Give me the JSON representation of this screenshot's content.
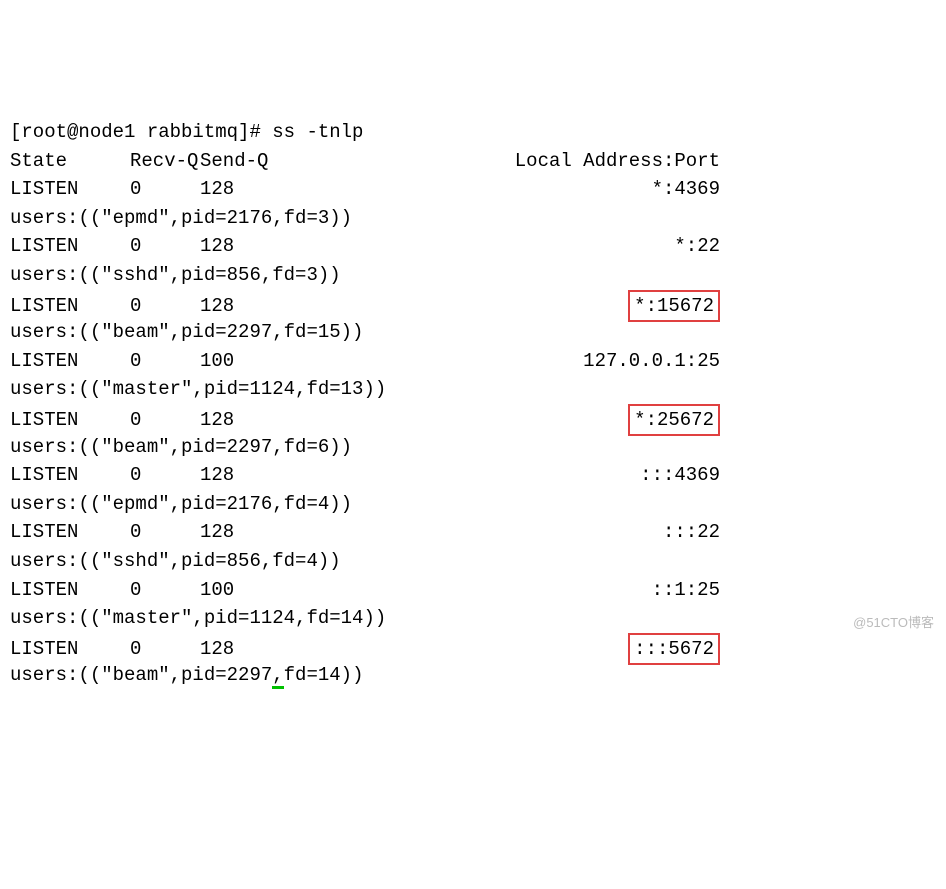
{
  "prompt": {
    "user": "root",
    "host": "node1",
    "cwd": "rabbitmq",
    "symbol": "#",
    "command": "ss -tnlp"
  },
  "header": {
    "state": "State",
    "recvq": "Recv-Q",
    "sendq": "Send-Q",
    "addr": "Local Address:Port"
  },
  "rows": [
    {
      "state": "LISTEN",
      "recvq": "0",
      "sendq": "128",
      "addr": "*:4369",
      "highlight": false,
      "users": "users:((\"epmd\",pid=2176,fd=3))"
    },
    {
      "state": "LISTEN",
      "recvq": "0",
      "sendq": "128",
      "addr": "*:22",
      "highlight": false,
      "users": "users:((\"sshd\",pid=856,fd=3))"
    },
    {
      "state": "LISTEN",
      "recvq": "0",
      "sendq": "128",
      "addr": "*:15672",
      "highlight": true,
      "users": "users:((\"beam\",pid=2297,fd=15))"
    },
    {
      "state": "LISTEN",
      "recvq": "0",
      "sendq": "100",
      "addr": "127.0.0.1:25",
      "highlight": false,
      "users": "users:((\"master\",pid=1124,fd=13))"
    },
    {
      "state": "LISTEN",
      "recvq": "0",
      "sendq": "128",
      "addr": "*:25672",
      "highlight": true,
      "users": "users:((\"beam\",pid=2297,fd=6))"
    },
    {
      "state": "LISTEN",
      "recvq": "0",
      "sendq": "128",
      "addr": ":::4369",
      "highlight": false,
      "users": "users:((\"epmd\",pid=2176,fd=4))"
    },
    {
      "state": "LISTEN",
      "recvq": "0",
      "sendq": "128",
      "addr": ":::22",
      "highlight": false,
      "users": "users:((\"sshd\",pid=856,fd=4))"
    },
    {
      "state": "LISTEN",
      "recvq": "0",
      "sendq": "100",
      "addr": "::1:25",
      "highlight": false,
      "users": "users:((\"master\",pid=1124,fd=14))"
    },
    {
      "state": "LISTEN",
      "recvq": "0",
      "sendq": "128",
      "addr": ":::5672",
      "highlight": true,
      "users_pre": "users:((\"beam\",pid=2297",
      "users_mid": ",",
      "users_post": "fd=14))",
      "green": true
    }
  ],
  "watermark": "@51CTO博客"
}
